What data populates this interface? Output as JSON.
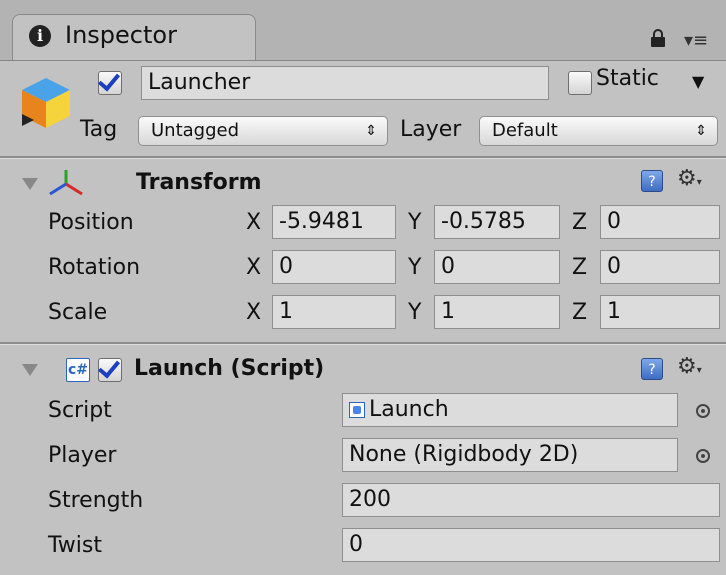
{
  "tab": {
    "title": "Inspector",
    "info_glyph": "i"
  },
  "header": {
    "name": "Launcher",
    "active": true,
    "static_label": "Static",
    "static_checked": false,
    "tag_label": "Tag",
    "tag_value": "Untagged",
    "layer_label": "Layer",
    "layer_value": "Default"
  },
  "transform": {
    "title": "Transform",
    "rows": [
      {
        "label": "Position",
        "x": "-5.9481",
        "y": "-0.5785",
        "z": "0"
      },
      {
        "label": "Rotation",
        "x": "0",
        "y": "0",
        "z": "0"
      },
      {
        "label": "Scale",
        "x": "1",
        "y": "1",
        "z": "1"
      }
    ],
    "axis_labels": [
      "X",
      "Y",
      "Z"
    ]
  },
  "script_component": {
    "title": "Launch (Script)",
    "enabled": true,
    "fields": [
      {
        "label": "Script",
        "value": "Launch"
      },
      {
        "label": "Player",
        "value": "None (Rigidbody 2D)"
      },
      {
        "label": "Strength",
        "value": "200"
      },
      {
        "label": "Twist",
        "value": "0"
      }
    ]
  },
  "icons": {
    "help": "?",
    "gear": "⚙",
    "popup_arrow": "⇕",
    "static_dropdown": "▼",
    "cs_glyph": "c#"
  }
}
